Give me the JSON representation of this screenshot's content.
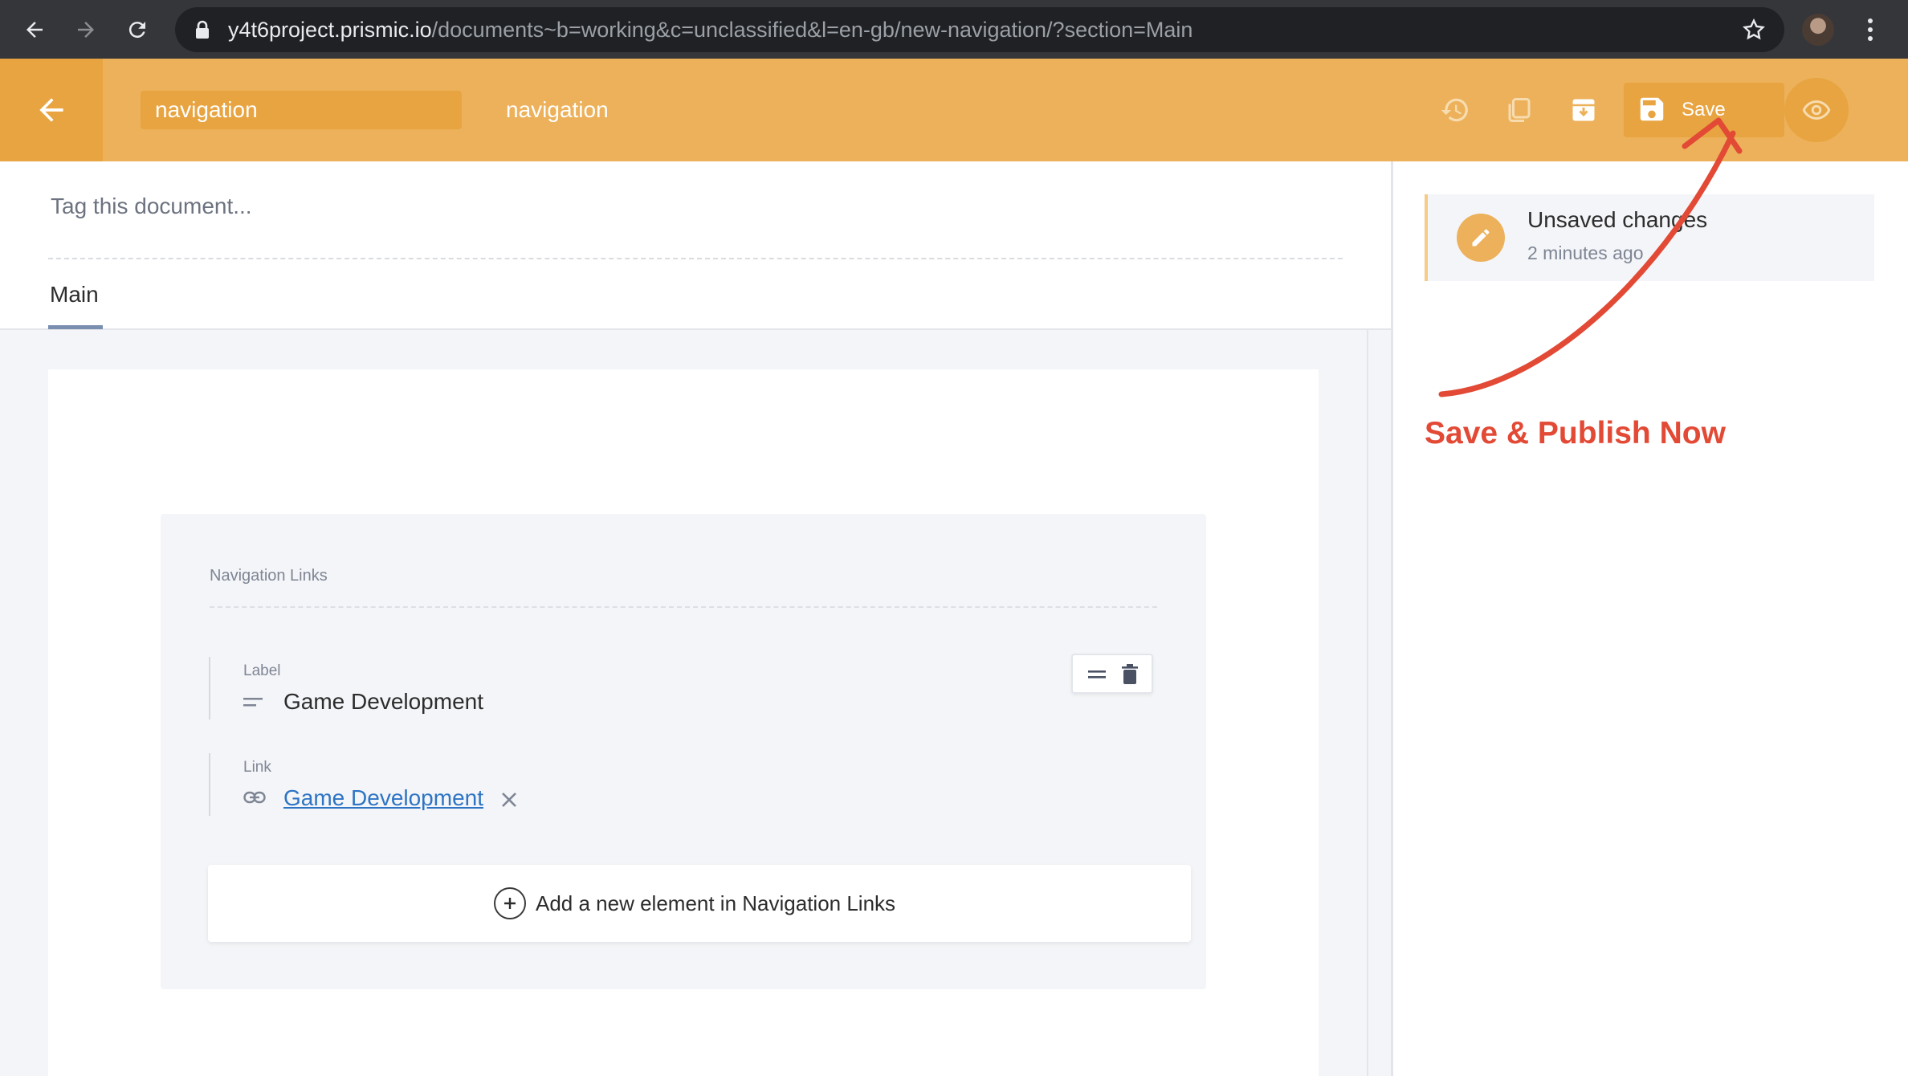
{
  "browser": {
    "url_host": "y4t6project.prismic.io",
    "url_path": "/documents~b=working&c=unclassified&l=en-gb/new-navigation/?section=Main"
  },
  "header": {
    "title_value": "navigation",
    "custom_type": "navigation",
    "save_label": "Save",
    "icons": [
      "back-arrow-icon",
      "history-icon",
      "duplicate-icon",
      "archive-icon",
      "save-icon",
      "preview-eye-icon"
    ]
  },
  "editor": {
    "tag_placeholder": "Tag this document...",
    "tabs": [
      {
        "label": "Main",
        "active": true
      }
    ],
    "group": {
      "title": "Navigation Links",
      "items": [
        {
          "label_field": {
            "label": "Label",
            "value": "Game Development"
          },
          "link_field": {
            "label": "Link",
            "value": "Game Development"
          }
        }
      ],
      "add_label": "Add a new element in Navigation Links"
    }
  },
  "sidebar": {
    "status_title": "Unsaved changes",
    "status_time": "2 minutes ago"
  },
  "annotation": {
    "text": "Save & Publish Now",
    "color": "#e24a36"
  },
  "theme": {
    "accent": "#ecb15a",
    "accent_dark": "#e8a441",
    "link": "#2d74c4"
  }
}
